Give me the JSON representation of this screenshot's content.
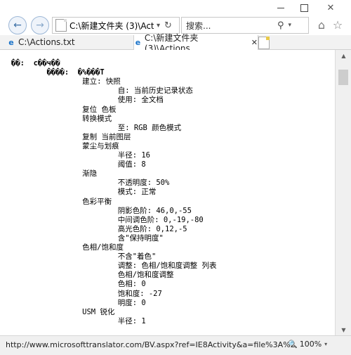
{
  "window": {
    "minimize_icon": "minimize-icon",
    "maximize_icon": "maximize-icon",
    "close_symbol": "✕"
  },
  "nav": {
    "back_symbol": "←",
    "forward_symbol": "→",
    "address_value": "C:\\新建文件夹 (3)\\Action",
    "address_dropdown": "▾",
    "refresh_symbol": "↻",
    "search_placeholder": "搜索...",
    "search_symbol": "⚲",
    "search_dropdown": "▾",
    "home_symbol": "⌂",
    "favorites_symbol": "☆"
  },
  "tabs": [
    {
      "label": "C:\\Actions.txt",
      "active": false
    },
    {
      "label": "C:\\新建文件夹 (3)\\Actions....",
      "active": true,
      "close": "✕"
    }
  ],
  "content": {
    "lines": [
      "��:  c��ч��",
      "        ����:  �%���T",
      "                建立: 快照",
      "                        自: 当前历史记录状态",
      "                        使用: 全文档",
      "                复位 色板",
      "                转换模式",
      "                        至: RGB 颜色模式",
      "                复制 当前图层",
      "                蒙尘与划痕",
      "                        半径: 16",
      "                        阈值: 8",
      "                渐隐",
      "                        不透明度: 50%",
      "                        模式: 正常",
      "                色彩平衡",
      "                        阴影色阶: 46,0,-55",
      "                        中间调色阶: 0,-19,-80",
      "                        高光色阶: 0,12,-5",
      "                        含\"保持明度\"",
      "                色相/饱和度",
      "                        不含\"着色\"",
      "                        调整: 色相/饱和度调整 列表",
      "                        色相/饱和度调整",
      "                        色相: 0",
      "                        饱和度: -27",
      "                        明度: 0",
      "                USM 锐化",
      "                        半径: 1"
    ]
  },
  "scrollbar": {
    "up": "▲",
    "down": "▼"
  },
  "status": {
    "url": "http://www.microsofttranslator.com/BV.aspx?ref=IE8Activity&a=file%3A%2",
    "zoom": "100%",
    "zoom_icon": "🔍",
    "zoom_dropdown": "▾"
  }
}
